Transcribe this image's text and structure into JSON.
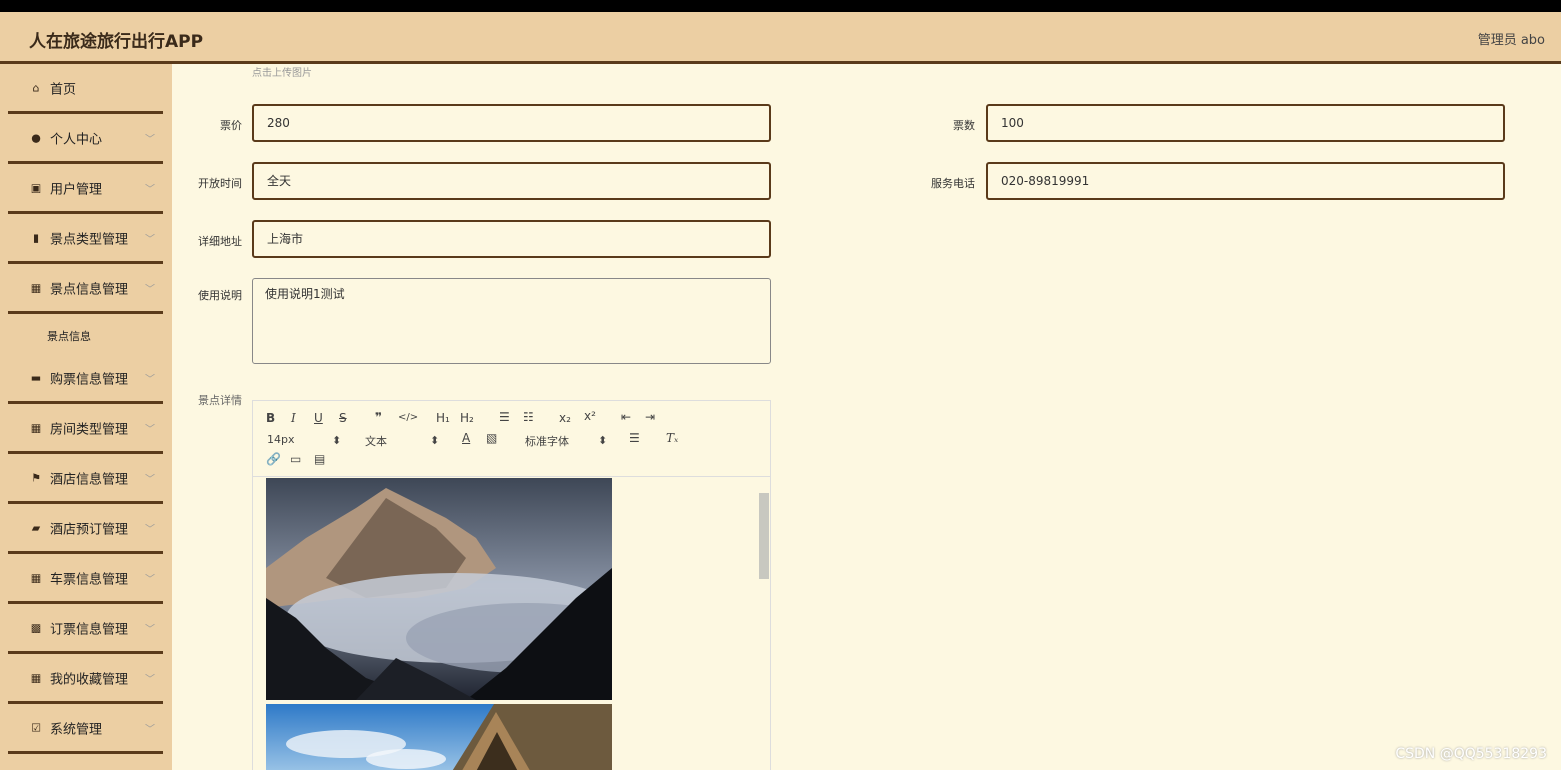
{
  "header": {
    "title": "人在旅途旅行出行APP",
    "user": "管理员 abo"
  },
  "sidebar": {
    "items": [
      {
        "label": "首页",
        "icon": "home-icon",
        "chevron": false
      },
      {
        "label": "个人中心",
        "icon": "user-icon",
        "chevron": true
      },
      {
        "label": "用户管理",
        "icon": "clipboard-icon",
        "chevron": true
      },
      {
        "label": "景点类型管理",
        "icon": "library-icon",
        "chevron": true
      },
      {
        "label": "景点信息管理",
        "icon": "grid-icon",
        "chevron": true
      },
      {
        "label": "购票信息管理",
        "icon": "ticket-icon",
        "chevron": true
      },
      {
        "label": "房间类型管理",
        "icon": "grid-icon",
        "chevron": true
      },
      {
        "label": "酒店信息管理",
        "icon": "flag-icon",
        "chevron": true
      },
      {
        "label": "酒店预订管理",
        "icon": "hotel-icon",
        "chevron": true
      },
      {
        "label": "车票信息管理",
        "icon": "grid-icon",
        "chevron": true
      },
      {
        "label": "订票信息管理",
        "icon": "table-icon",
        "chevron": true
      },
      {
        "label": "我的收藏管理",
        "icon": "grid-icon",
        "chevron": true
      },
      {
        "label": "系统管理",
        "icon": "checklist-icon",
        "chevron": true
      }
    ],
    "submenu": {
      "label": "景点信息"
    }
  },
  "form": {
    "upload_hint": "点击上传图片",
    "price_label": "票价",
    "price_value": "280",
    "count_label": "票数",
    "count_value": "100",
    "open_label": "开放时间",
    "open_value": "全天",
    "phone_label": "服务电话",
    "phone_value": "020-89819991",
    "address_label": "详细地址",
    "address_value": "上海市",
    "usage_label": "使用说明",
    "usage_value": "使用说明1测试",
    "detail_label": "景点详情"
  },
  "editor": {
    "font_size": "14px",
    "text_style": "文本",
    "font_family": "标准字体"
  },
  "watermark": "CSDN @QQ55318293"
}
